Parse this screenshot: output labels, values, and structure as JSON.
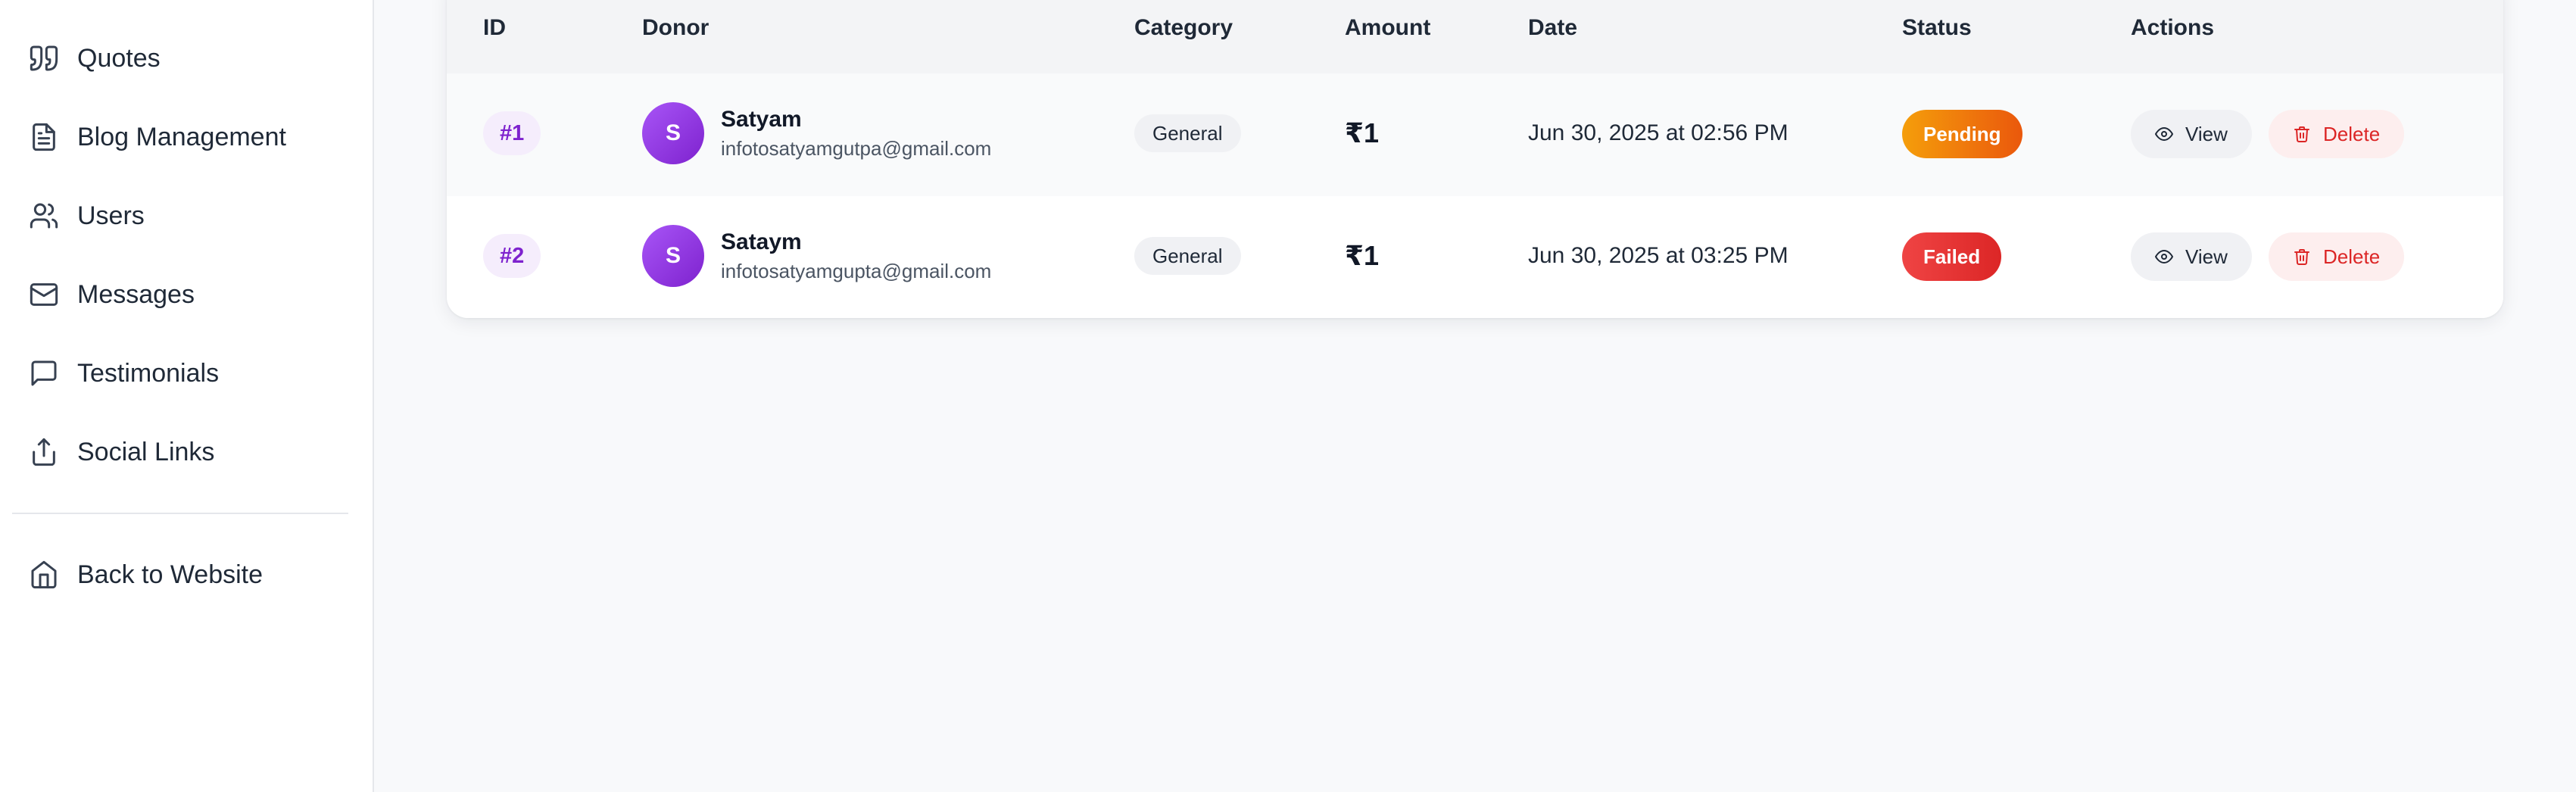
{
  "sidebar": {
    "items": [
      {
        "label": "Quotes",
        "icon": "quote-icon"
      },
      {
        "label": "Blog Management",
        "icon": "file-text-icon"
      },
      {
        "label": "Users",
        "icon": "users-icon"
      },
      {
        "label": "Messages",
        "icon": "mail-icon"
      },
      {
        "label": "Testimonials",
        "icon": "message-square-icon"
      },
      {
        "label": "Social Links",
        "icon": "share-icon"
      }
    ],
    "back": {
      "label": "Back to Website",
      "icon": "home-icon"
    }
  },
  "table": {
    "columns": {
      "id": "ID",
      "donor": "Donor",
      "category": "Category",
      "amount": "Amount",
      "date": "Date",
      "status": "Status",
      "actions": "Actions"
    },
    "rows": [
      {
        "id": "#1",
        "avatar_initial": "S",
        "name": "Satyam",
        "email": "infotosatyamgutpa@gmail.com",
        "category": "General",
        "amount": "₹1",
        "date": "Jun 30, 2025 at 02:56 PM",
        "status": "Pending",
        "view_label": "View",
        "delete_label": "Delete"
      },
      {
        "id": "#2",
        "avatar_initial": "S",
        "name": "Sataym",
        "email": "infotosatyamgupta@gmail.com",
        "category": "General",
        "amount": "₹1",
        "date": "Jun 30, 2025 at 03:25 PM",
        "status": "Failed",
        "view_label": "View",
        "delete_label": "Delete"
      }
    ]
  },
  "colors": {
    "accent_purple": "#7e22ce",
    "pending": "#f59e0b",
    "failed": "#ef4444",
    "delete": "#dc2626"
  }
}
